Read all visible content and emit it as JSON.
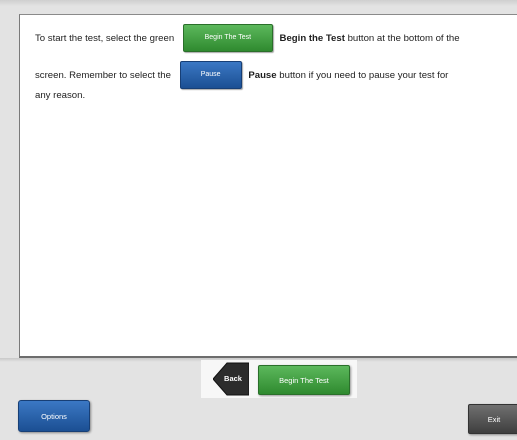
{
  "instructions": {
    "line1_prefix": "To start the test, select the green",
    "line1_button": "Begin The Test",
    "line1_bold": "Begin the Test",
    "line1_suffix": "button at the bottom of the",
    "line2_prefix": "screen. Remember to select the",
    "line2_button": "Pause",
    "line2_bold": "Pause",
    "line2_suffix": "button if you need to pause your test for",
    "line3": "any reason."
  },
  "nav": {
    "back_label": "Back",
    "begin_label": "Begin The Test"
  },
  "footer": {
    "options_label": "Options",
    "exit_label": "Exit"
  },
  "colors": {
    "green": "#3f9e3f",
    "blue": "#2561ad",
    "gray": "#555555"
  }
}
